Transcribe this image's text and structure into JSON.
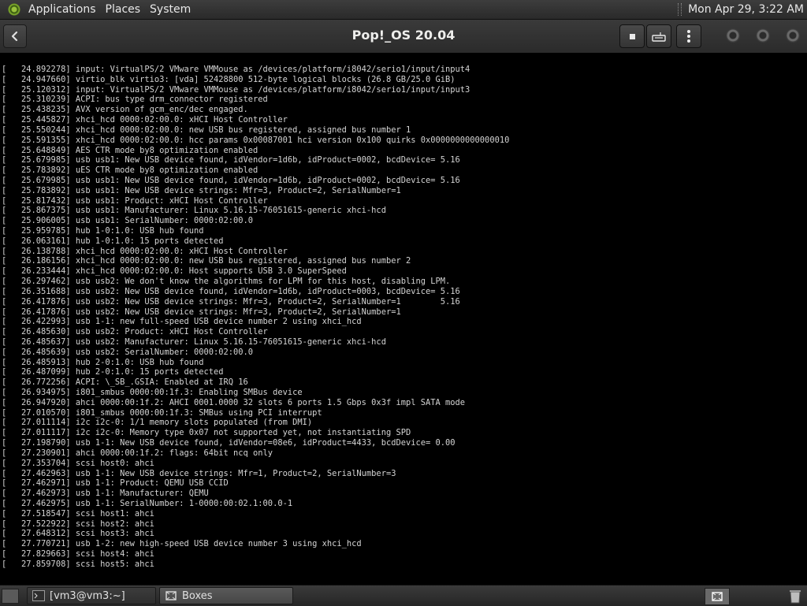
{
  "top_panel": {
    "menus": [
      "Applications",
      "Places",
      "System"
    ],
    "clock": "Mon Apr 29,  3:22 AM",
    "icons": {
      "logo": "gnome-foot-icon"
    }
  },
  "header": {
    "title": "Pop!_OS 20.04",
    "icons": {
      "back": "back-arrow-icon",
      "stop": "stop-icon",
      "keyboard": "keyboard-icon",
      "menu": "vertical-dots-menu-icon",
      "window_controls": "round-window-button-icon"
    }
  },
  "console_lines": [
    "[   24.892278] input: VirtualPS/2 VMware VMMouse as /devices/platform/i8042/serio1/input/input4",
    "[   24.947660] virtio_blk virtio3: [vda] 52428800 512-byte logical blocks (26.8 GB/25.0 GiB)",
    "[   25.120312] input: VirtualPS/2 VMware VMMouse as /devices/platform/i8042/serio1/input/input3",
    "[   25.310239] ACPI: bus type drm_connector registered",
    "[   25.438235] AVX version of gcm_enc/dec engaged.",
    "[   25.445827] xhci_hcd 0000:02:00.0: xHCI Host Controller",
    "[   25.550244] xhci_hcd 0000:02:00.0: new USB bus registered, assigned bus number 1",
    "[   25.591355] xhci_hcd 0000:02:00.0: hcc params 0x00087001 hci version 0x100 quirks 0x0000000000000010",
    "[   25.648849] AES CTR mode by8 optimization enabled",
    "[   25.679985] usb usb1: New USB device found, idVendor=1d6b, idProduct=0002, bcdDevice= 5.16",
    "[   25.783892] uES CTR mode by8 optimization enabled",
    "[   25.679985] usb usb1: New USB device found, idVendor=1d6b, idProduct=0002, bcdDevice= 5.16",
    "[   25.783892] usb usb1: New USB device strings: Mfr=3, Product=2, SerialNumber=1",
    "[   25.817432] usb usb1: Product: xHCI Host Controller",
    "[   25.867375] usb usb1: Manufacturer: Linux 5.16.15-76051615-generic xhci-hcd",
    "[   25.906005] usb usb1: SerialNumber: 0000:02:00.0",
    "[   25.959785] hub 1-0:1.0: USB hub found",
    "[   26.063161] hub 1-0:1.0: 15 ports detected",
    "[   26.138788] xhci_hcd 0000:02:00.0: xHCI Host Controller",
    "[   26.186156] xhci_hcd 0000:02:00.0: new USB bus registered, assigned bus number 2",
    "[   26.233444] xhci_hcd 0000:02:00.0: Host supports USB 3.0 SuperSpeed",
    "[   26.297462] usb usb2: We don't know the algorithms for LPM for this host, disabling LPM.",
    "[   26.351688] usb usb2: New USB device found, idVendor=1d6b, idProduct=0003, bcdDevice= 5.16",
    "[   26.417876] usb usb2: New USB device strings: Mfr=3, Product=2, SerialNumber=1        5.16",
    "[   26.417876] usb usb2: New USB device strings: Mfr=3, Product=2, SerialNumber=1",
    "[   26.422993] usb 1-1: new full-speed USB device number 2 using xhci_hcd",
    "[   26.485630] usb usb2: Product: xHCI Host Controller",
    "[   26.485637] usb usb2: Manufacturer: Linux 5.16.15-76051615-generic xhci-hcd",
    "[   26.485639] usb usb2: SerialNumber: 0000:02:00.0",
    "[   26.485913] hub 2-0:1.0: USB hub found",
    "[   26.487099] hub 2-0:1.0: 15 ports detected",
    "[   26.772256] ACPI: \\_SB_.GSIA: Enabled at IRQ 16",
    "[   26.934975] i801_smbus 0000:00:1f.3: Enabling SMBus device",
    "[   26.947920] ahci 0000:00:1f.2: AHCI 0001.0000 32 slots 6 ports 1.5 Gbps 0x3f impl SATA mode",
    "[   27.010570] i801_smbus 0000:00:1f.3: SMBus using PCI interrupt",
    "[   27.011114] i2c i2c-0: 1/1 memory slots populated (from DMI)",
    "[   27.011117] i2c i2c-0: Memory type 0x07 not supported yet, not instantiating SPD",
    "[   27.198790] usb 1-1: New USB device found, idVendor=08e6, idProduct=4433, bcdDevice= 0.00",
    "[   27.230901] ahci 0000:00:1f.2: flags: 64bit ncq only",
    "[   27.353704] scsi host0: ahci",
    "[   27.462963] usb 1-1: New USB device strings: Mfr=1, Product=2, SerialNumber=3",
    "[   27.462971] usb 1-1: Product: QEMU USB CCID",
    "[   27.462973] usb 1-1: Manufacturer: QEMU",
    "[   27.462975] usb 1-1: SerialNumber: 1-0000:00:02.1:00.0-1",
    "[   27.518547] scsi host1: ahci",
    "[   27.522922] scsi host2: ahci",
    "[   27.648312] scsi host3: ahci",
    "[   27.770721] usb 1-2: new high-speed USB device number 3 using xhci_hcd",
    "[   27.829663] scsi host4: ahci",
    "[   27.859708] scsi host5: ahci"
  ],
  "bottom_panel": {
    "tasks": [
      {
        "label": "[vm3@vm3:~]",
        "icon": "terminal-icon"
      },
      {
        "label": "Boxes",
        "icon": "boxes-icon"
      }
    ],
    "icons": {
      "show_desktop": "show-desktop-icon",
      "workspace": "workspace-switcher-icon",
      "trash": "trash-icon"
    }
  }
}
